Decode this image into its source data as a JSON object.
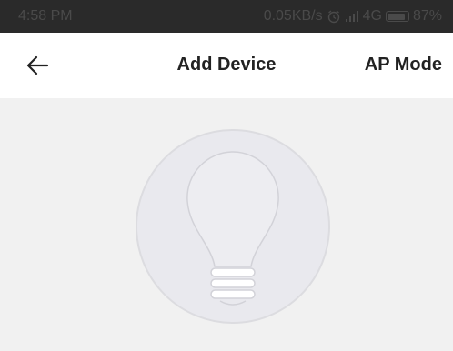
{
  "status_bar": {
    "time": "4:58 PM",
    "network_speed": "0.05KB/s",
    "network_type": "4G",
    "battery": "87%",
    "icons": [
      "alarm-icon",
      "signal-icon",
      "battery-icon"
    ]
  },
  "header": {
    "back_icon": "back-arrow-icon",
    "title": "Add Device",
    "ap_mode_label": "AP Mode"
  },
  "main": {
    "illustration_icon": "light-bulb-icon"
  },
  "colors": {
    "status_bar_bg": "#2a2a2a",
    "main_bg": "#f1f1f1",
    "title_text": "#222222",
    "circle_fill": "#e9e9ee"
  }
}
